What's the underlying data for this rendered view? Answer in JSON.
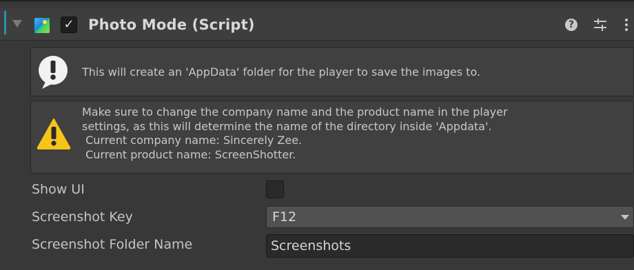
{
  "component": {
    "title": "Photo Mode (Script)",
    "enabled": true,
    "icons": {
      "foldout": "triangle-down-icon",
      "script": "image-script-icon",
      "help": "question-icon",
      "presets": "sliders-icon",
      "menu": "kebab-menu-icon"
    },
    "help_glyph": "?",
    "check_glyph": "✓"
  },
  "help_boxes": {
    "info": {
      "icon": "info-exclamation-icon",
      "text": "This will create an 'AppData' folder for the player to save the images to."
    },
    "warning": {
      "icon": "warning-triangle-icon",
      "text": "Make sure to change the company name and the product name in the player\nsettings, as this will determine the name of the directory inside 'Appdata'.\n Current company name: Sincerely Zee.\n Current product name: ScreenShotter."
    }
  },
  "properties": {
    "show_ui": {
      "label": "Show UI",
      "value": false
    },
    "screenshot_key": {
      "label": "Screenshot Key",
      "value": "F12"
    },
    "screenshot_folder": {
      "label": "Screenshot Folder Name",
      "value": "Screenshots"
    }
  },
  "colors": {
    "background": "#383838",
    "header": "#3e3e3e",
    "accent": "#2f8fb0",
    "warning": "#f5c518"
  }
}
